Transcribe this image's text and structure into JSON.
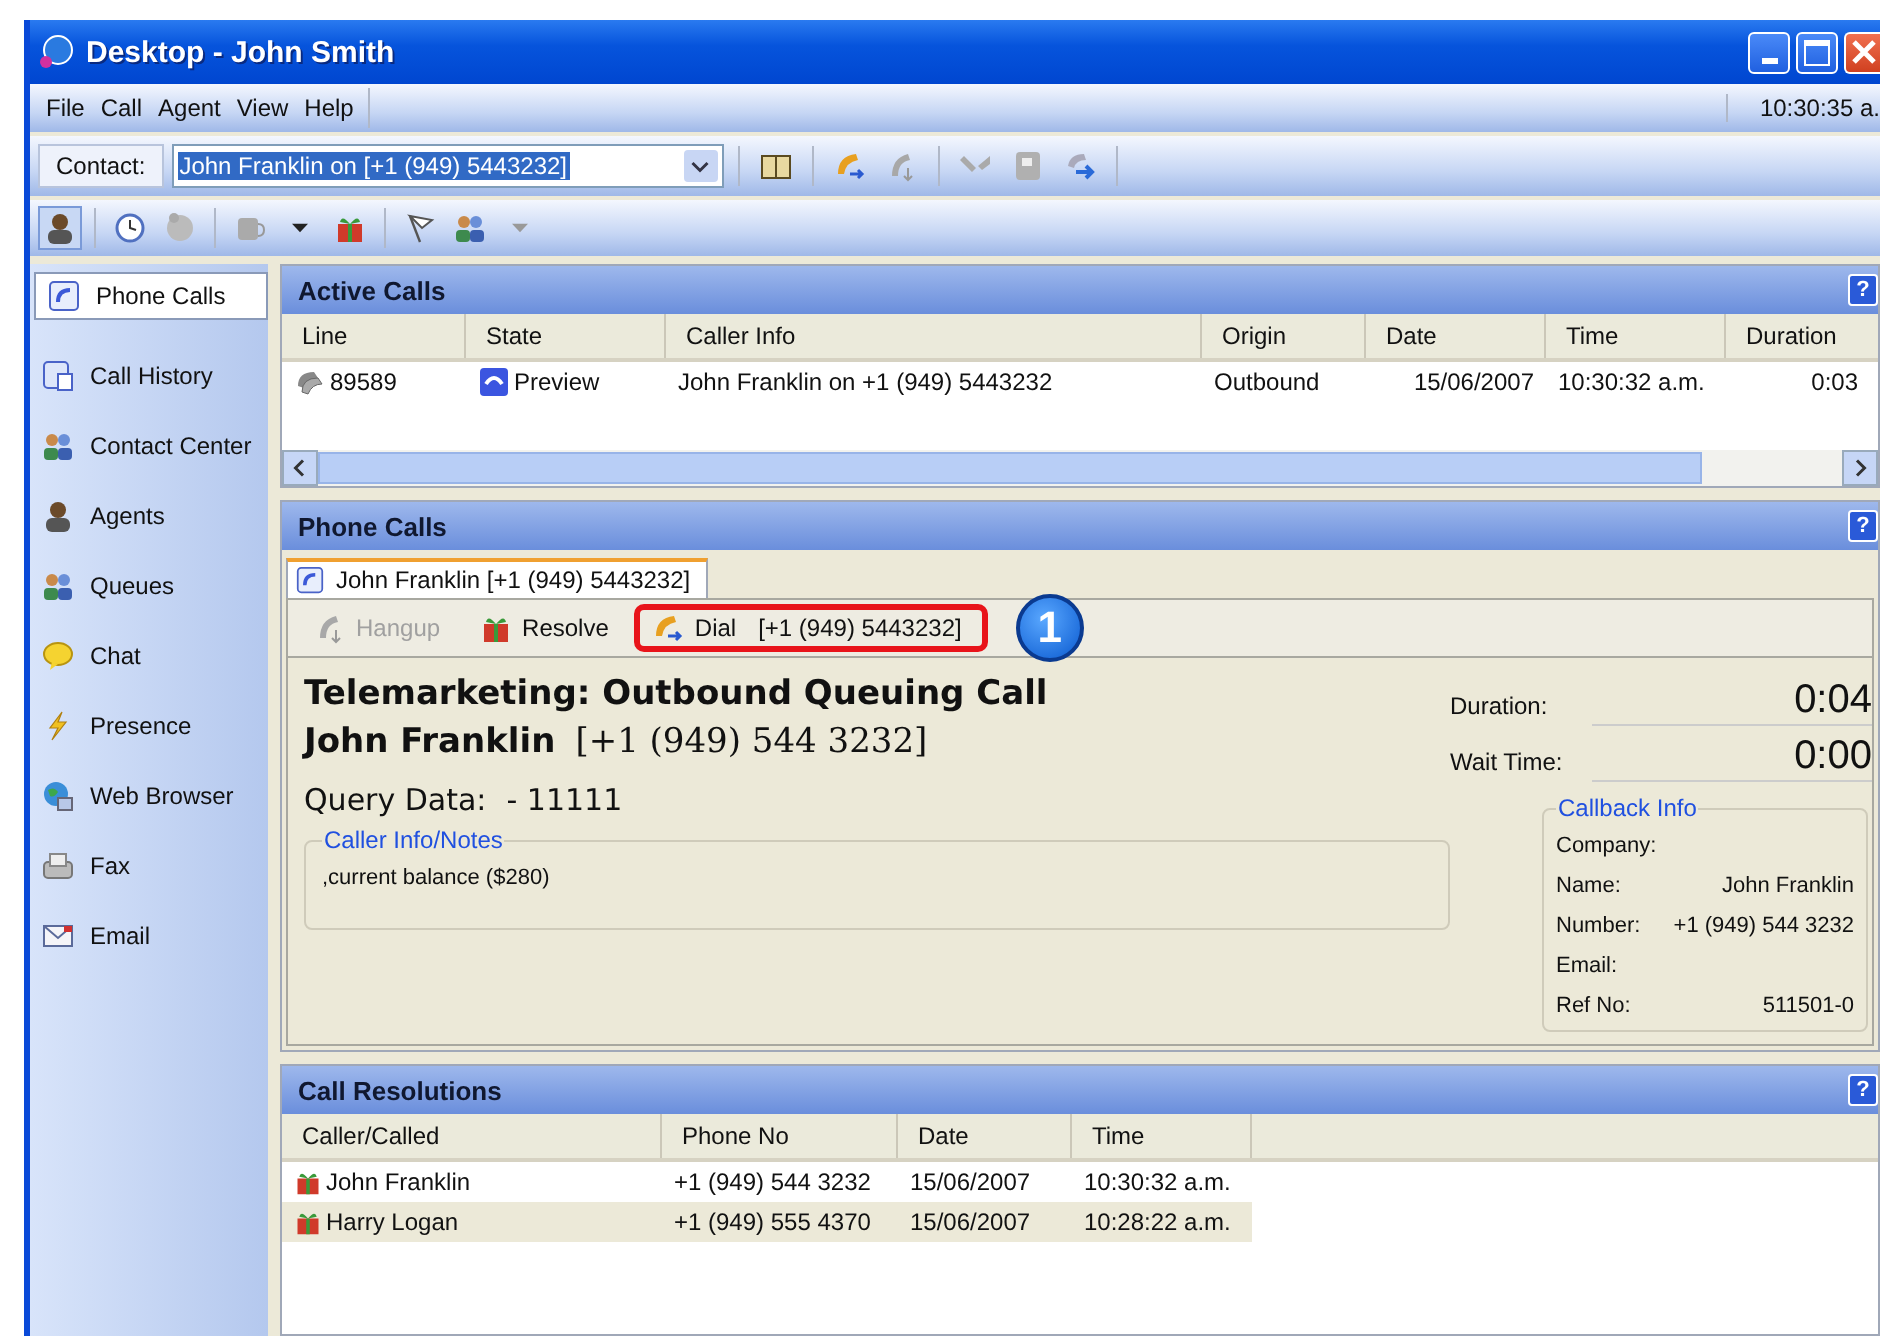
{
  "window": {
    "title": "Desktop - John Smith",
    "clock": "10:30:35 a."
  },
  "menu": [
    "File",
    "Call",
    "Agent",
    "View",
    "Help"
  ],
  "contact": {
    "label": "Contact:",
    "value": "John Franklin on [+1 (949) 5443232]"
  },
  "sidebar": {
    "items": [
      {
        "label": "Phone Calls",
        "selected": true
      },
      {
        "label": "Call History",
        "selected": false
      },
      {
        "label": "Contact Center",
        "selected": false
      },
      {
        "label": "Agents",
        "selected": false
      },
      {
        "label": "Queues",
        "selected": false
      },
      {
        "label": "Chat",
        "selected": false
      },
      {
        "label": "Presence",
        "selected": false
      },
      {
        "label": "Web Browser",
        "selected": false
      },
      {
        "label": "Fax",
        "selected": false
      },
      {
        "label": "Email",
        "selected": false
      }
    ]
  },
  "active_calls": {
    "title": "Active Calls",
    "help": "?",
    "columns": [
      "Line",
      "State",
      "Caller Info",
      "Origin",
      "Date",
      "Time",
      "Duration"
    ],
    "rows": [
      {
        "line": "89589",
        "state": "Preview",
        "caller_info": "John Franklin on +1 (949) 5443232",
        "origin": "Outbound",
        "date": "15/06/2007",
        "time": "10:30:32 a.m.",
        "duration": "0:03"
      }
    ]
  },
  "phone_calls": {
    "title": "Phone Calls",
    "help": "?",
    "tabs": [
      {
        "label": "John Franklin [+1 (949) 5443232]",
        "selected": true
      }
    ],
    "actions": [
      {
        "kind": "hangup",
        "label": "Hangup",
        "disabled": true,
        "highlighted": false
      },
      {
        "kind": "resolve",
        "label": "Resolve",
        "disabled": false,
        "highlighted": false
      },
      {
        "kind": "dial",
        "label": "Dial",
        "number": "[+1 (949) 5443232]",
        "disabled": false,
        "highlighted": true
      }
    ],
    "callout": "1",
    "heading": "Telemarketing: Outbound Queuing Call",
    "caller_name": "John Franklin",
    "caller_number": "[+1 (949) 544 3232]",
    "query_label": "Query Data:",
    "query_value": "- 11111",
    "notes": {
      "title": "Caller Info/Notes",
      "text": ",current balance ($280)"
    },
    "timers": [
      {
        "label": "Duration:",
        "value": "0:04"
      },
      {
        "label": "Wait Time:",
        "value": "0:00"
      }
    ],
    "callback": {
      "title": "Callback Info",
      "fields": [
        {
          "label": "Company:"
        },
        {
          "label": "Name:",
          "value": "John Franklin"
        },
        {
          "label": "Number:",
          "value": "+1 (949) 544 3232"
        },
        {
          "label": "Email:"
        },
        {
          "label": "Ref No:",
          "value": "511501-0"
        }
      ]
    }
  },
  "call_resolutions": {
    "title": "Call Resolutions",
    "help": "?",
    "columns": [
      "Caller/Called",
      "Phone No",
      "Date",
      "Time"
    ],
    "rows": [
      {
        "caller": "John Franklin",
        "phone": "+1 (949) 544 3232",
        "date": "15/06/2007",
        "time": "10:30:32 a.m."
      },
      {
        "caller": "Harry Logan",
        "phone": "+1 (949) 555 4370",
        "date": "15/06/2007",
        "time": "10:28:22 a.m."
      }
    ]
  }
}
